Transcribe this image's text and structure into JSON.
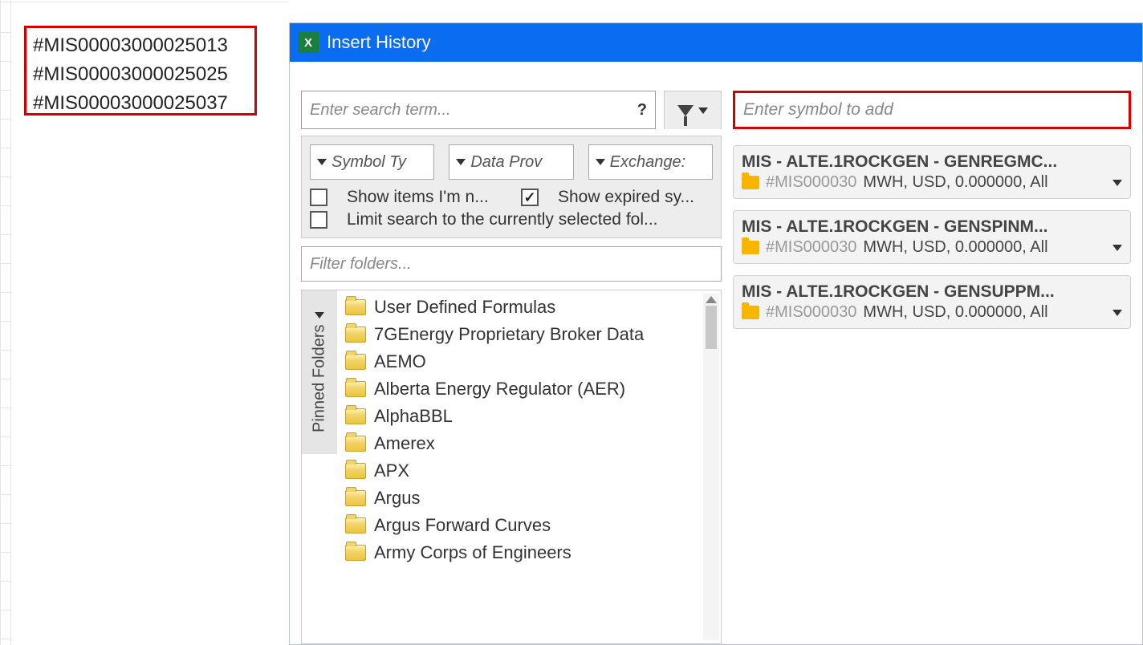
{
  "sheet": {
    "cells": [
      "#MIS00003000025013",
      "#MIS00003000025025",
      "#MIS00003000025037"
    ]
  },
  "dialog": {
    "title": "Insert History",
    "search_placeholder": "Enter search term...",
    "search_help": "?",
    "filters": {
      "symbol_type": "Symbol Ty",
      "data_prov": "Data Prov",
      "exchanges": "Exchange:"
    },
    "checks": {
      "show_items": "Show items I'm n...",
      "show_expired": "Show expired sy...",
      "limit_search": "Limit search to the currently selected fol..."
    },
    "folder_filter_placeholder": "Filter folders...",
    "pinned_label": "Pinned Folders",
    "folders": [
      "User Defined Formulas",
      "7GEnergy Proprietary Broker Data",
      "AEMO",
      "Alberta Energy Regulator (AER)",
      "AlphaBBL",
      "Amerex",
      "APX",
      "Argus",
      "Argus Forward Curves",
      "Army Corps of Engineers"
    ],
    "symbol_add_placeholder": "Enter symbol to add",
    "symbols": [
      {
        "title": "MIS - ALTE.1ROCKGEN - GENREGMC...",
        "code": "#MIS000030",
        "rest": "MWH, USD, 0.000000, All"
      },
      {
        "title": "MIS - ALTE.1ROCKGEN - GENSPINM...",
        "code": "#MIS000030",
        "rest": "MWH, USD, 0.000000, All"
      },
      {
        "title": "MIS - ALTE.1ROCKGEN - GENSUPPM...",
        "code": "#MIS000030",
        "rest": "MWH, USD, 0.000000, All"
      }
    ]
  }
}
